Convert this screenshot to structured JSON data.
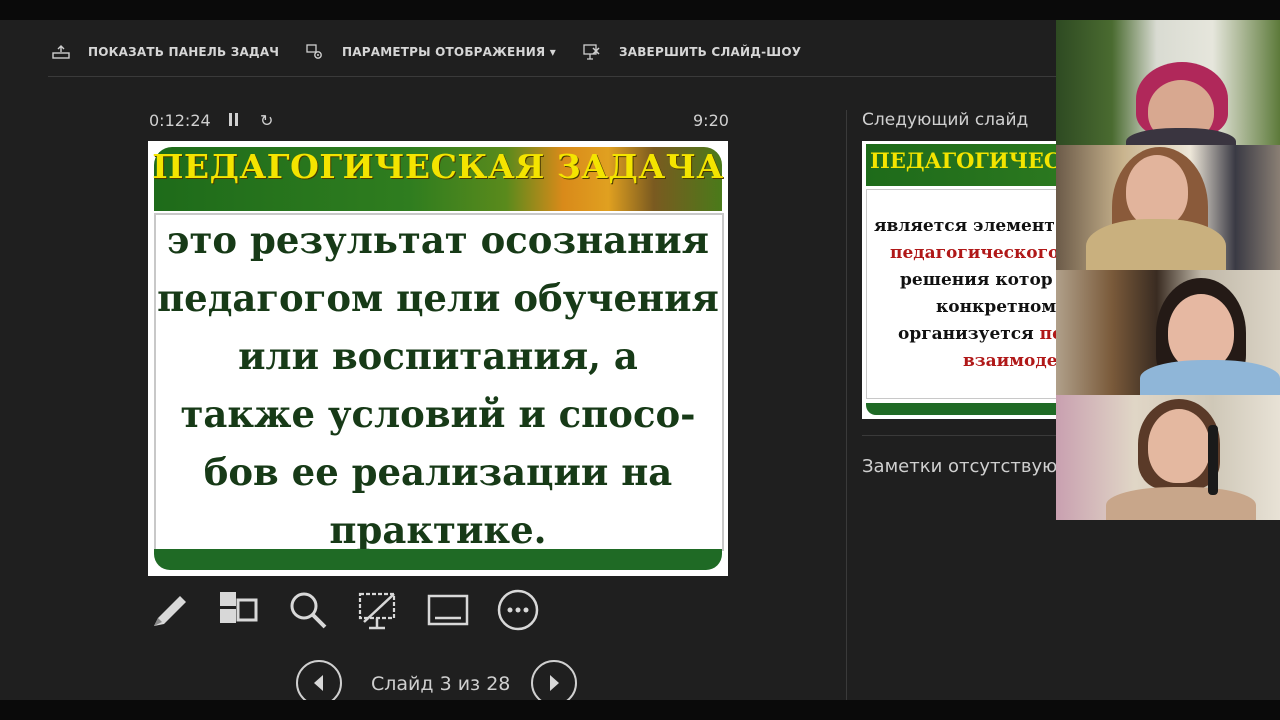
{
  "toolbar": {
    "show_taskbar": "ПОКАЗАТЬ ПАНЕЛЬ ЗАДАЧ",
    "display_settings": "ПАРАМЕТРЫ ОТОБРАЖЕНИЯ ▾",
    "end_show": "ЗАВЕРШИТЬ СЛАЙД-ШОУ"
  },
  "presenter": {
    "elapsed_time": "0:12:24",
    "clock": "9:20",
    "slide_counter": "Слайд 3 из 28"
  },
  "current_slide": {
    "title": "ПЕДАГОГИЧЕСКАЯ ЗАДАЧА",
    "body_lines": [
      "это результат осознания",
      "педагогом цели обучения",
      "или  воспитания,  а",
      "также  условий  и  спосо-",
      "бов  ее реализации на",
      "практике."
    ]
  },
  "next_slide": {
    "label": "Следующий слайд",
    "title": "ПЕДАГОГИЧЕС",
    "lines": [
      {
        "text": "является элемент",
        "color": "#111111"
      },
      {
        "text": "педагогического",
        "color": "#b01818"
      },
      {
        "text": "решения котор",
        "color": "#111111"
      },
      {
        "text": "конкретном",
        "color": "#111111"
      },
      {
        "text_black": "организуется ",
        "text_red": "пе"
      },
      {
        "text": "взаимоде",
        "color": "#b01818"
      }
    ]
  },
  "notes": {
    "text": "Заметки отсутствую"
  },
  "tools": [
    "pen-icon",
    "slides-grid-icon",
    "zoom-icon",
    "black-screen-icon",
    "subtitles-icon",
    "more-icon"
  ],
  "colors": {
    "background": "#1f1f1f",
    "slide_title": "#f4e400",
    "slide_banner": "#1e6b1a",
    "slide_text": "#173a17",
    "accent_red": "#b01818"
  }
}
